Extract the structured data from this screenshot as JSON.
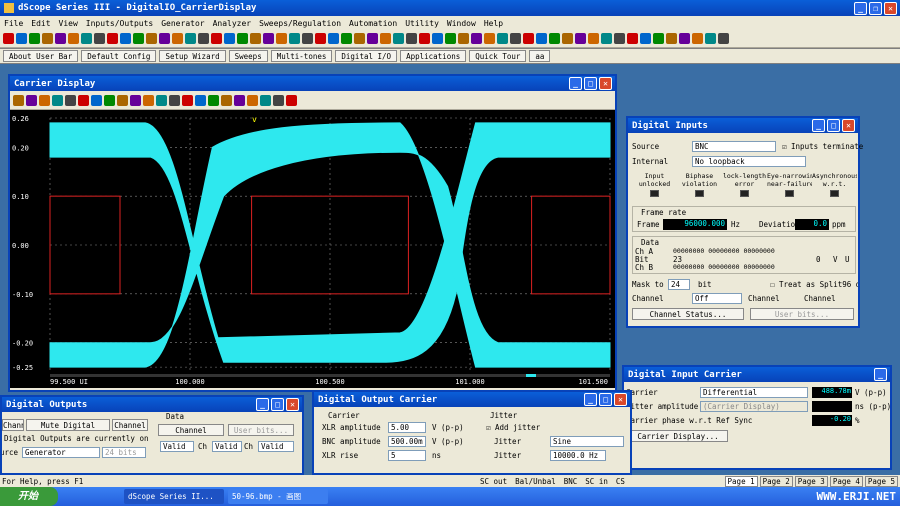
{
  "app": {
    "title": "dScope Series III - DigitalIO_CarrierDisplay"
  },
  "menu": [
    "File",
    "Edit",
    "View",
    "Inputs/Outputs",
    "Generator",
    "Analyzer",
    "Sweeps/Regulation",
    "Automation",
    "Utility",
    "Window",
    "Help"
  ],
  "quickbar": [
    "About User Bar",
    "Default Config",
    "Setup Wizard",
    "Sweeps",
    "Multi-tones",
    "Digital I/O",
    "Applications",
    "Quick Tour",
    "aa"
  ],
  "carrier_display": {
    "title": "Carrier Display"
  },
  "chart_data": {
    "type": "line",
    "y_ticks": [
      "0.26",
      "0.20",
      "0.10",
      "0.00",
      "-0.10",
      "-0.20",
      "-0.25"
    ],
    "x_ticks": [
      "99.500 UI",
      "100.000",
      "100.500",
      "101.000",
      "101.500"
    ],
    "ylim": [
      -0.26,
      0.26
    ],
    "xlim": [
      99.5,
      101.5
    ],
    "marker": "v",
    "grid": true
  },
  "digital_inputs": {
    "title": "Digital Inputs",
    "source_label": "Source",
    "source_value": "BNC",
    "term_label": "Inputs terminate",
    "internal_label": "Internal",
    "internal_value": "No loopback",
    "status_heads": [
      "Input\nunlocked",
      "Biphase\nviolation",
      "lock-length\nerror",
      "Eye-narrowing\nnear-failure",
      "Asynchronous\nw.r.t."
    ],
    "frame_rate_label": "Frame rate",
    "frame_label": "Frame",
    "frame_value": "96000.000",
    "hz": "Hz",
    "deviation_label": "Deviatio",
    "deviation_value": "0.0",
    "ppm": "ppm",
    "data_label": "Data",
    "cha": "Ch A",
    "bit": "Bit",
    "chb": "Ch B",
    "bit23": "23",
    "bit0": "0",
    "v": "V",
    "u": "U",
    "bits_a": "00000000 00000000 00000000",
    "bits_b": "00000000 00000000 00000000",
    "mask_label": "Mask to",
    "mask_value": "24",
    "mask_unit": "bit",
    "split_label": "Treat as Split96 da",
    "channel_label": "Channel",
    "channel_value": "Off",
    "channel2": "Channel",
    "channel3": "Channel",
    "status_btn": "Channel Status...",
    "userbits_btn": "User bits..."
  },
  "digital_outputs": {
    "title": "Digital Outputs",
    "tab1": "Channel A",
    "tab2": "Mute Digital Outputs",
    "tab3": "Channel B",
    "note": "Digital Outputs are currently on",
    "source_label": "Source",
    "source_value": "Generator",
    "bits_value": "24 bits",
    "data_label": "Data",
    "chstatus_btn": "Channel Status...",
    "userbits_btn": "User bits...",
    "valid1": "Valid",
    "ch1": "Ch",
    "valid2": "Valid",
    "ch2": "Ch",
    "valid3": "Valid"
  },
  "output_carrier": {
    "title": "Digital Output Carrier",
    "carrier_label": "Carrier",
    "xlr_label": "XLR amplitude",
    "xlr_value": "5.00",
    "vpp": "V (p-p)",
    "bnc_label": "BNC amplitude",
    "bnc_value": "500.00m",
    "vpp2": "V (p-p)",
    "rise_label": "XLR rise",
    "rise_value": "5",
    "ns": "ns",
    "jitter_label": "Jitter",
    "add_jitter": "Add jitter",
    "jitter_type_label": "Jitter",
    "jitter_type": "Sine",
    "jitter_freq_label": "Jitter",
    "jitter_freq": "10000.0 Hz"
  },
  "input_carrier": {
    "title": "Digital Input Carrier",
    "carrier_label": "Carrier",
    "carrier_value": "Differential",
    "carrier_reading": "488.78m",
    "vpp": "V (p-p)",
    "jitter_label": "Jitter amplitude",
    "jitter_value": "(Carrier Display)",
    "ns": "ns (p-p)",
    "phase_label": "Carrier phase w.r.t Ref Sync",
    "phase_value": "-0.20",
    "pct": "%",
    "display_btn": "Carrier Display..."
  },
  "status": {
    "help": "For Help, press F1",
    "items": [
      "SC out",
      "Bal/Unbal",
      "BNC",
      "SC in",
      "CS"
    ],
    "pages": [
      "Page 1",
      "Page 2",
      "Page 3",
      "Page 4",
      "Page 5"
    ]
  },
  "taskbar": {
    "start": "开始",
    "task1": "dScope Series II...",
    "task2": "50-96.bmp - 画图",
    "brand": "WWW.ERJI.NET"
  }
}
